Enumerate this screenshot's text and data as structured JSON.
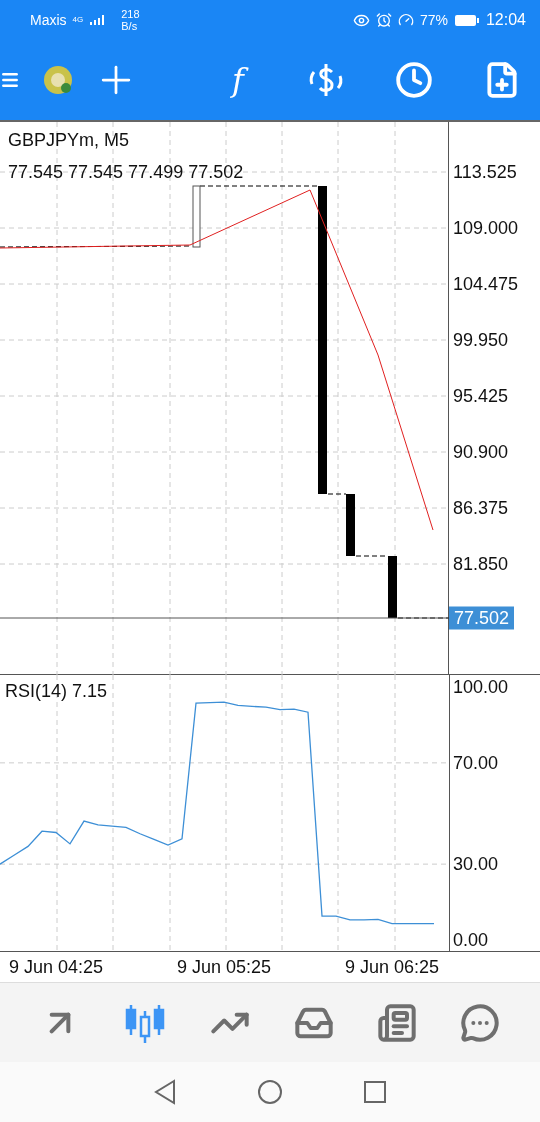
{
  "status_bar": {
    "carrier": "Maxis",
    "network": "4G",
    "speed_value": "218",
    "speed_unit": "B/s",
    "battery_percent": "77%",
    "time": "12:04"
  },
  "toolbar": {
    "function_label": "f"
  },
  "price_chart": {
    "symbol": "GBPJPYm, M5",
    "ohlc": "77.545 77.545 77.499 77.502",
    "axis_labels": [
      "113.525",
      "109.000",
      "104.475",
      "99.950",
      "95.425",
      "90.900",
      "86.375",
      "81.850"
    ],
    "current_price": "77.502"
  },
  "rsi_chart": {
    "value": "7.15",
    "chart_data": {
      "type": "line",
      "categories": [
        null,
        null,
        null,
        null,
        "9 Jun 04:25",
        null,
        null,
        null,
        null,
        null,
        null,
        null,
        null,
        null,
        null,
        null,
        "9 Jun 05:25",
        null,
        null,
        null,
        null,
        null,
        null,
        null,
        null,
        null,
        null,
        null,
        "9 Jun 06:25",
        null,
        null,
        null
      ],
      "grid": true,
      "ylim": [
        -4.7,
        104.7
      ],
      "yticks": [
        {
          "value": 100,
          "label": "100.00"
        },
        {
          "value": 70,
          "label": "70.00"
        },
        {
          "value": 30,
          "label": "30.00"
        },
        {
          "value": 0,
          "label": "0.00"
        }
      ],
      "series": [
        {
          "name": "RSI(14)",
          "color": "#3d8fd6",
          "values": [
            30,
            33.5,
            37,
            43,
            42.5,
            38,
            47,
            45.5,
            45,
            44.5,
            42,
            39.8,
            37.5,
            40,
            93.6,
            93.8,
            94,
            92.7,
            92.3,
            92,
            91,
            91.2,
            90,
            9.5,
            9.5,
            8,
            8,
            8.2,
            6.5,
            6.5,
            6.5,
            6.5
          ]
        }
      ]
    }
  },
  "bottom_nav": [
    {
      "kind": "trade",
      "selected": false
    },
    {
      "kind": "chart",
      "selected": true
    },
    {
      "kind": "trend",
      "selected": false
    },
    {
      "kind": "inbox",
      "selected": false
    },
    {
      "kind": "news",
      "selected": false
    },
    {
      "kind": "chat",
      "selected": false
    }
  ]
}
